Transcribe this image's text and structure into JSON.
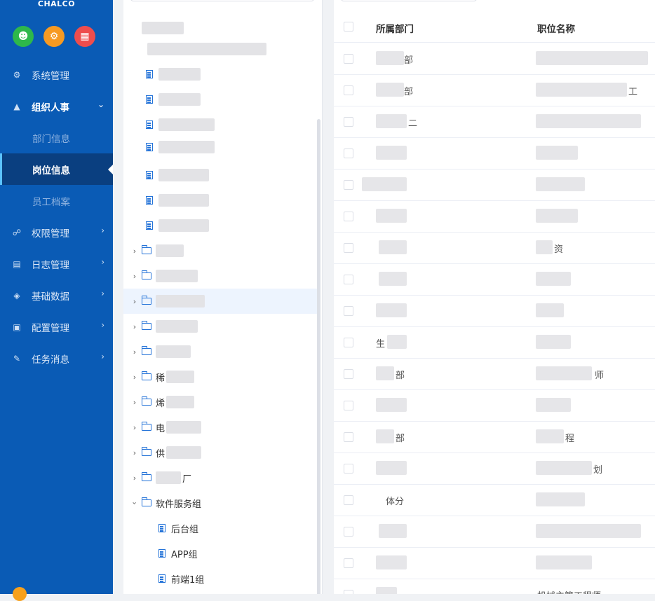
{
  "app": {
    "logo_text": "CHALCO"
  },
  "quick_actions": [
    {
      "icon": "user-icon",
      "color": "#2eb84b"
    },
    {
      "icon": "gear-icon",
      "color": "#f79a22"
    },
    {
      "icon": "grid-icon",
      "color": "#ee4d4d"
    }
  ],
  "sidebar": {
    "items": [
      {
        "label": "系统管理",
        "icon": "gears-icon"
      },
      {
        "label": "组织人事",
        "icon": "org-icon",
        "open": true
      },
      {
        "label": "部门信息",
        "sub": true
      },
      {
        "label": "岗位信息",
        "sub": true,
        "active": true
      },
      {
        "label": "员工档案",
        "sub": true
      },
      {
        "label": "权限管理",
        "icon": "lock-icon"
      },
      {
        "label": "日志管理",
        "icon": "log-icon"
      },
      {
        "label": "基础数据",
        "icon": "layers-icon"
      },
      {
        "label": "配置管理",
        "icon": "config-icon"
      },
      {
        "label": "任务消息",
        "icon": "task-icon"
      }
    ]
  },
  "tree": {
    "visible_labels": {
      "n13": "稀",
      "n14": "烯",
      "n15": "电",
      "n16": "供",
      "n17": "厂",
      "n18": "软件服务组",
      "n19": "后台组",
      "n20": "APP组",
      "n21": "前端1组"
    }
  },
  "table": {
    "columns": {
      "dept": "所属部门",
      "position": "职位名称"
    },
    "rows": [
      {
        "dept": "部",
        "position": ""
      },
      {
        "dept": "部",
        "position": "工"
      },
      {
        "dept": "二",
        "position": ""
      },
      {
        "dept": "",
        "position": ""
      },
      {
        "dept": "",
        "position": ""
      },
      {
        "dept": "",
        "position": ""
      },
      {
        "dept": "",
        "position": "资"
      },
      {
        "dept": "",
        "position": ""
      },
      {
        "dept": "",
        "position": ""
      },
      {
        "dept": "生",
        "position": ""
      },
      {
        "dept": "部",
        "position": "师"
      },
      {
        "dept": "",
        "position": ""
      },
      {
        "dept": "部",
        "position": "程"
      },
      {
        "dept": "",
        "position": "划"
      },
      {
        "dept": "体分",
        "position": ""
      },
      {
        "dept": "",
        "position": ""
      },
      {
        "dept": "",
        "position": ""
      },
      {
        "dept": "",
        "position": "机械主管工程师"
      }
    ]
  }
}
